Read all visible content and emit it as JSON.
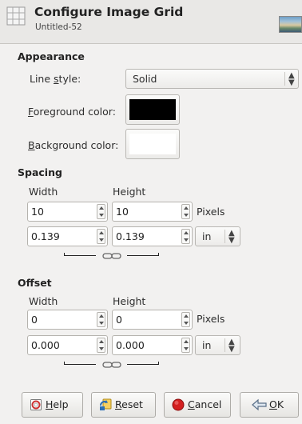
{
  "header": {
    "title": "Configure Image Grid",
    "subtitle": "Untitled-52",
    "icon": "grid-icon"
  },
  "appearance": {
    "section_label": "Appearance",
    "line_style": {
      "label_pre": "Line ",
      "label_u": "s",
      "label_post": "tyle:",
      "value": "Solid"
    },
    "foreground": {
      "label_u": "F",
      "label_post": "oreground color:",
      "color": "#000000"
    },
    "background": {
      "label_u": "B",
      "label_post": "ackground color:",
      "color": "#ffffff"
    }
  },
  "spacing": {
    "section_label": "Spacing",
    "width_label": "Width",
    "height_label": "Height",
    "width_px": "10",
    "height_px": "10",
    "px_unit": "Pixels",
    "width_in": "0.139",
    "height_in": "0.139",
    "unit_value": "in"
  },
  "offset": {
    "section_label": "Offset",
    "width_label": "Width",
    "height_label": "Height",
    "width_px": "0",
    "height_px": "0",
    "px_unit": "Pixels",
    "width_in": "0.000",
    "height_in": "0.000",
    "unit_value": "in"
  },
  "buttons": {
    "help": {
      "label_u": "H",
      "label_post": "elp",
      "icon": "help-icon"
    },
    "reset": {
      "label_u": "R",
      "label_post": "eset",
      "icon": "reset-icon"
    },
    "cancel": {
      "label_u": "C",
      "label_post": "ancel",
      "icon": "cancel-icon"
    },
    "ok": {
      "label_u": "O",
      "label_post": "K",
      "icon": "ok-icon"
    }
  }
}
